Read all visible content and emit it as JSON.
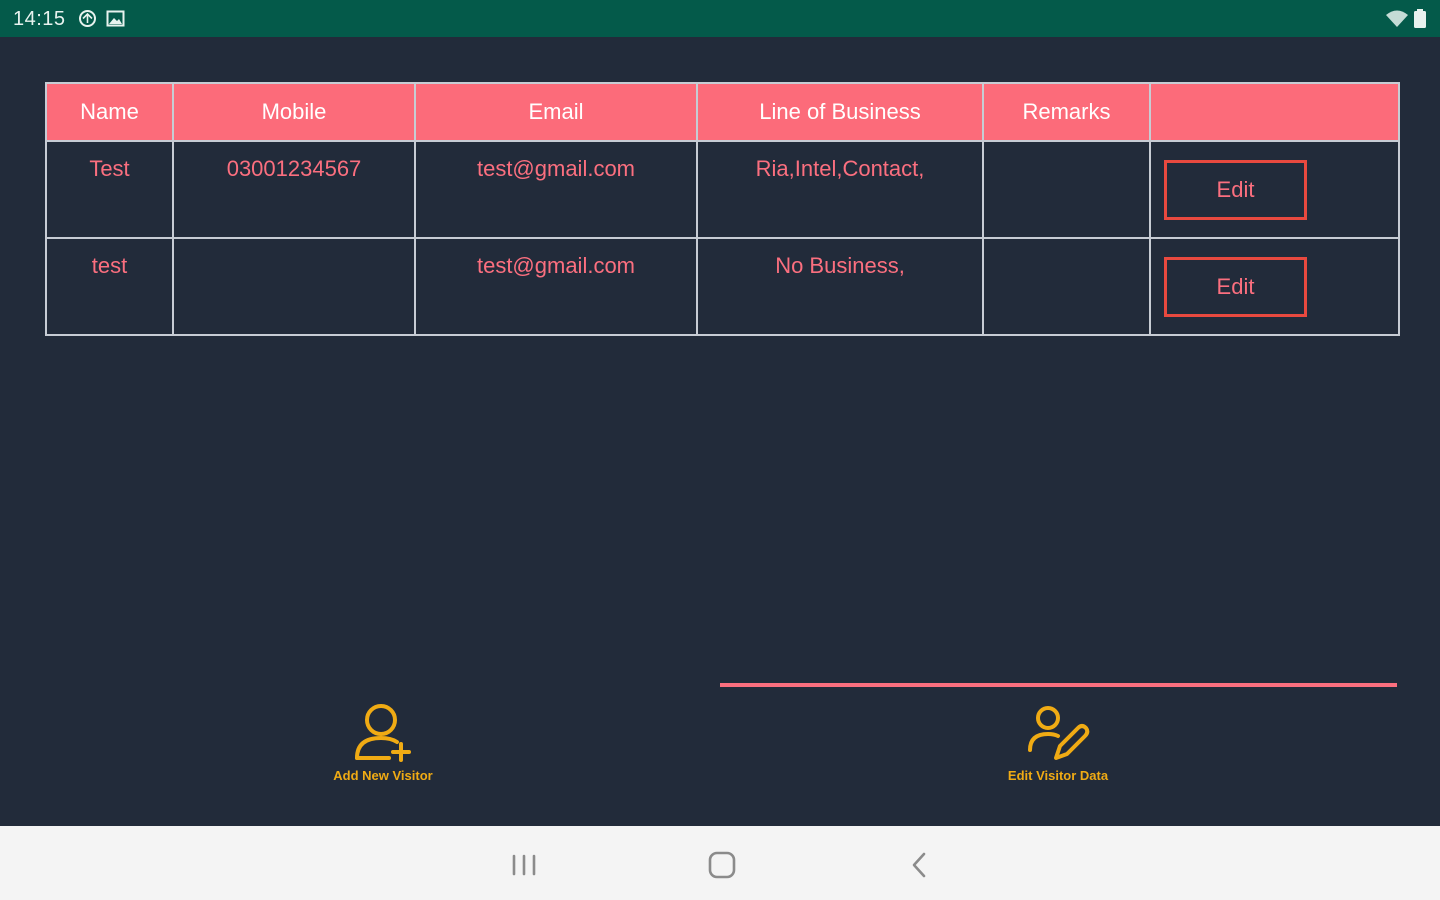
{
  "status_bar": {
    "time": "14:15",
    "icons": [
      "sync-icon",
      "gallery-icon",
      "wifi-icon",
      "battery-icon"
    ]
  },
  "table": {
    "headers": [
      "Name",
      "Mobile",
      "Email",
      "Line of Business",
      "Remarks",
      ""
    ],
    "rows": [
      {
        "name": "Test",
        "mobile": "03001234567",
        "email": "test@gmail.com",
        "business": "Ria,Intel,Contact,",
        "remarks": "",
        "action": "Edit"
      },
      {
        "name": "test",
        "mobile": "",
        "email": "test@gmail.com",
        "business": "No Business,",
        "remarks": "",
        "action": "Edit"
      }
    ]
  },
  "bottom_nav": {
    "tabs": [
      {
        "label": "Add New Visitor",
        "icon": "add-user-icon",
        "selected": false
      },
      {
        "label": "Edit Visitor Data",
        "icon": "edit-user-icon",
        "selected": true
      }
    ]
  },
  "system_nav": {
    "icons": [
      "recents-icon",
      "home-icon",
      "back-icon"
    ]
  },
  "colors": {
    "background": "#222b3a",
    "status_bar": "#045a4a",
    "header": "#fc6b7a",
    "accent_text": "#fb6f7f",
    "button_border": "#e9493f",
    "tab_icon": "#f0ab14",
    "system_nav": "#f4f4f4"
  }
}
